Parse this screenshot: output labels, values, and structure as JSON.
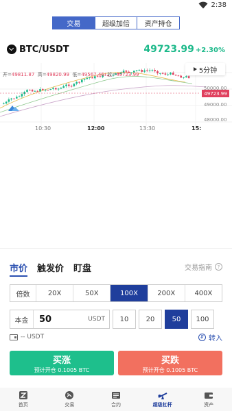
{
  "status": {
    "time": "2:38"
  },
  "top_tabs": [
    {
      "label": "交易",
      "active": true
    },
    {
      "label": "超级加倍",
      "active": false
    },
    {
      "label": "资产持仓",
      "active": false
    }
  ],
  "pair": {
    "symbol": "BTC/USDT",
    "price": "49723.99",
    "change": "+2.30%"
  },
  "chart": {
    "ohlc": {
      "open_label": "开=",
      "open": "49811.87",
      "high_label": "高=",
      "high": "49820.99",
      "low_label": "低=",
      "low": "49567.46",
      "close_label": "收=",
      "close": "49723.99"
    },
    "interval": "5分钟",
    "y_labels": [
      "50000.00",
      "49000.00",
      "48000.00"
    ],
    "last_price": "49723.99",
    "x_labels": [
      "10:30",
      "12:00",
      "13:30",
      "15:"
    ]
  },
  "order_tabs": [
    {
      "label": "市价",
      "active": true
    },
    {
      "label": "触发价",
      "active": false
    },
    {
      "label": "盯盘",
      "active": false
    }
  ],
  "guide_label": "交易指南",
  "leverage": {
    "label": "倍数",
    "options": [
      "20X",
      "50X",
      "100X",
      "200X",
      "400X"
    ],
    "selected": "100X"
  },
  "amount": {
    "label": "本金",
    "value": "50",
    "unit": "USDT",
    "quick": [
      "10",
      "20",
      "50",
      "100"
    ],
    "quick_selected": "50"
  },
  "balance": {
    "text": "-- USDT",
    "transfer_label": "转入"
  },
  "actions": {
    "buy": {
      "label": "买涨",
      "sub": "预计开仓 0.1005 BTC",
      "color": "#1ebf8c"
    },
    "sell": {
      "label": "买跌",
      "sub": "预计开仓 0.1005 BTC",
      "color": "#f2705f"
    }
  },
  "nav": [
    {
      "label": "首页",
      "icon": "home-icon"
    },
    {
      "label": "交易",
      "icon": "trade-icon"
    },
    {
      "label": "合约",
      "icon": "contract-icon"
    },
    {
      "label": "超级杠杆",
      "icon": "leverage-icon",
      "active": true
    },
    {
      "label": "资产",
      "icon": "wallet-icon"
    }
  ]
}
